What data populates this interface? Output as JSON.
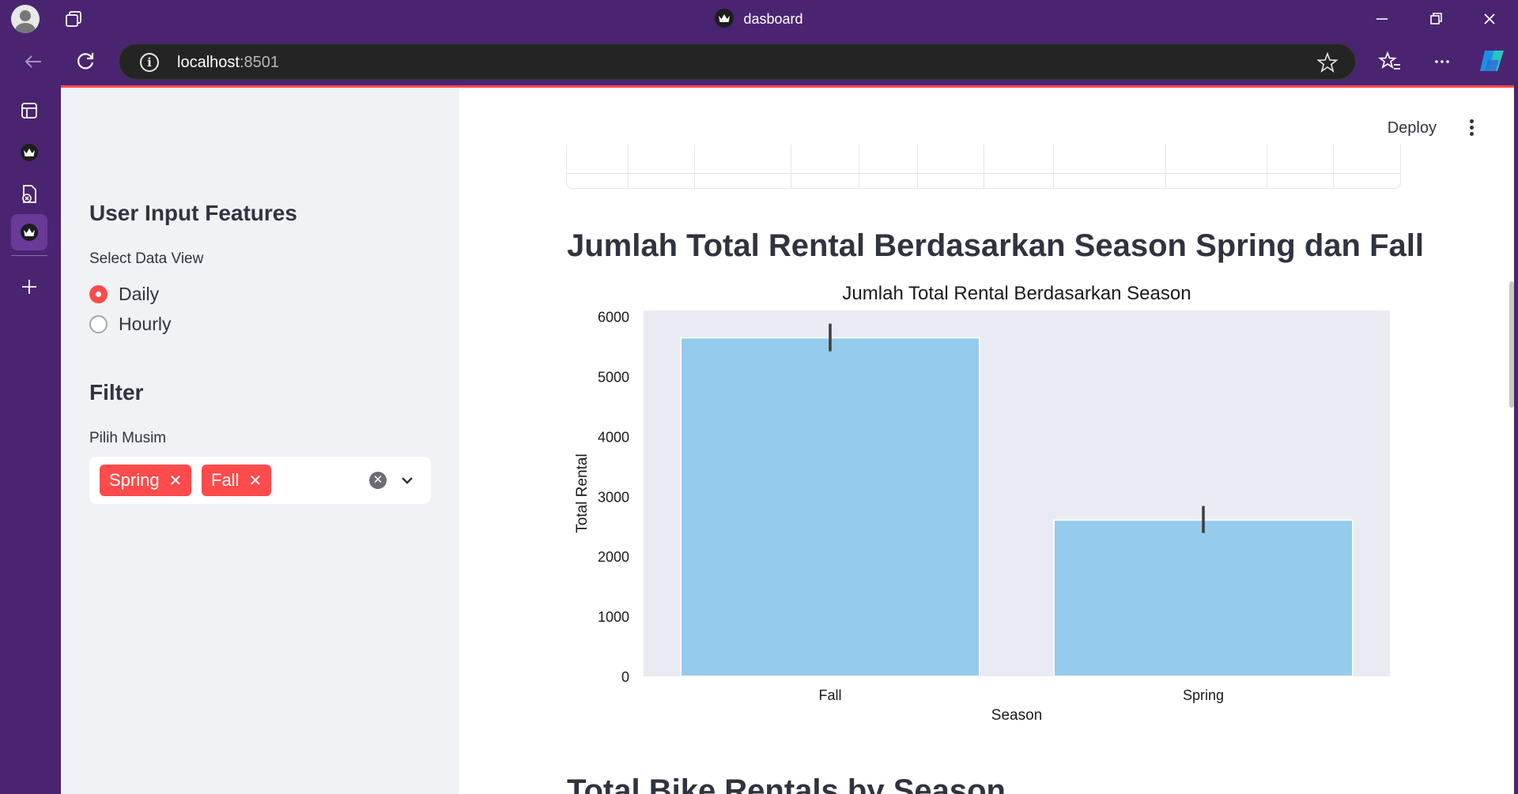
{
  "browser": {
    "window_title": "dasboard",
    "url_host": "localhost",
    "url_port": ":8501"
  },
  "sidebar": {
    "heading": "User Input Features",
    "view_label": "Select Data View",
    "view_options": [
      "Daily",
      "Hourly"
    ],
    "view_selected": "Daily",
    "filter_heading": "Filter",
    "season_label": "Pilih Musim",
    "season_selected": [
      "Spring",
      "Fall"
    ]
  },
  "main": {
    "deploy_label": "Deploy",
    "heading": "Jumlah Total Rental Berdasarkan Season Spring dan Fall",
    "next_heading": "Total Bike Rentals by Season"
  },
  "colors": {
    "accent": "#ff4b4b",
    "bar": "#95cbec",
    "plot_bg": "#eaeaf2",
    "browser_frame": "#4a2470"
  },
  "chart_data": {
    "type": "bar",
    "title": "Jumlah Total Rental Berdasarkan Season",
    "xlabel": "Season",
    "ylabel": "Total Rental",
    "categories": [
      "Fall",
      "Spring"
    ],
    "values": [
      5644,
      2604
    ],
    "error_bars": [
      [
        5420,
        5880
      ],
      [
        2390,
        2840
      ]
    ],
    "ylim": [
      0,
      6100
    ],
    "yticks": [
      0,
      1000,
      2000,
      3000,
      4000,
      5000,
      6000
    ],
    "grid": false
  }
}
